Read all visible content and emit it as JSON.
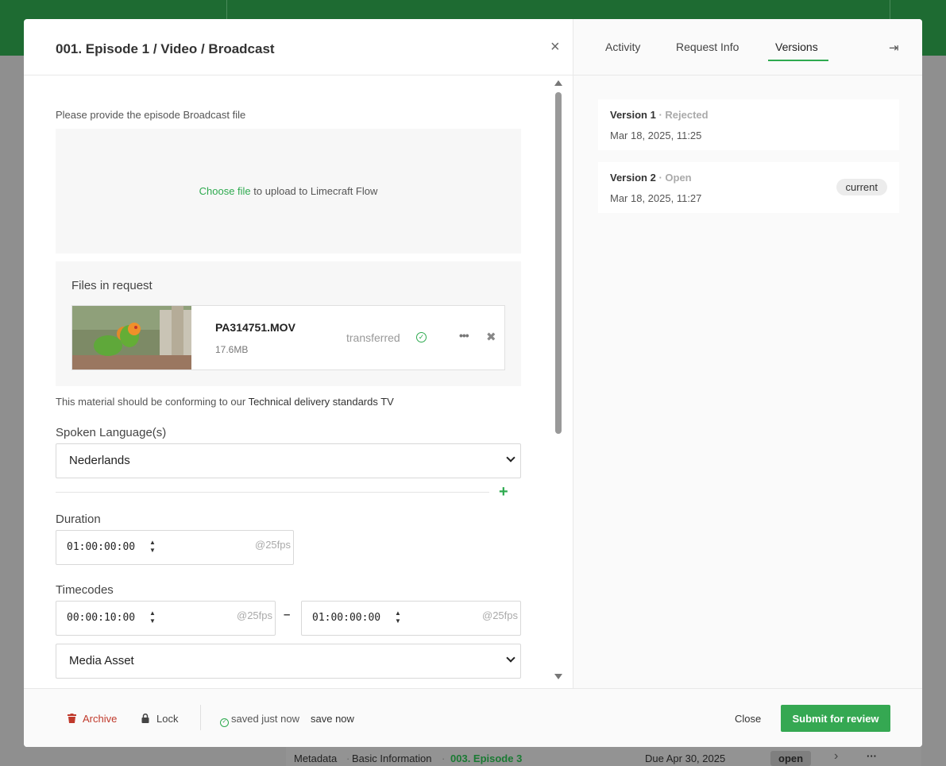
{
  "modal": {
    "title": "001. Episode 1 / Video / Broadcast",
    "upload_prompt": "Please provide the episode Broadcast file",
    "dropzone": {
      "link": "Choose file",
      "rest": " to upload to Limecraft Flow"
    },
    "files_title": "Files in request",
    "file": {
      "name": "PA314751.MOV",
      "size": "17.6MB",
      "status": "transferred"
    },
    "conform_prefix": "This material should be conforming to our ",
    "conform_link": "Technical delivery standards TV",
    "language": {
      "label": "Spoken Language(s)",
      "value": "Nederlands"
    },
    "duration": {
      "label": "Duration",
      "value": "01:00:00:00",
      "fps": "@25fps"
    },
    "timecodes": {
      "label": "Timecodes",
      "start": "00:00:10:00",
      "end": "01:00:00:00",
      "fps": "@25fps",
      "separator": "–"
    },
    "media_type": {
      "value": "Media Asset"
    }
  },
  "panel": {
    "tabs": [
      "Activity",
      "Request Info",
      "Versions"
    ],
    "active_tab": "Versions",
    "versions": [
      {
        "name": "Version 1",
        "status": "Rejected",
        "date": "Mar 18, 2025, 11:25",
        "badge": ""
      },
      {
        "name": "Version 2",
        "status": "Open",
        "date": "Mar 18, 2025, 11:27",
        "badge": "current"
      }
    ]
  },
  "footer": {
    "archive": "Archive",
    "lock": "Lock",
    "saved": "saved just now",
    "save_now": "save now",
    "close": "Close",
    "submit": "Submit for review"
  },
  "background": {
    "breadcrumb_1": "Metadata",
    "breadcrumb_2": "Basic Information",
    "breadcrumb_3": "003. Episode 3",
    "due": "Due Apr 30, 2025",
    "status": "open"
  },
  "colors": {
    "accent": "#35a852",
    "danger": "#c0392b",
    "header_bg": "#1e6b32"
  }
}
